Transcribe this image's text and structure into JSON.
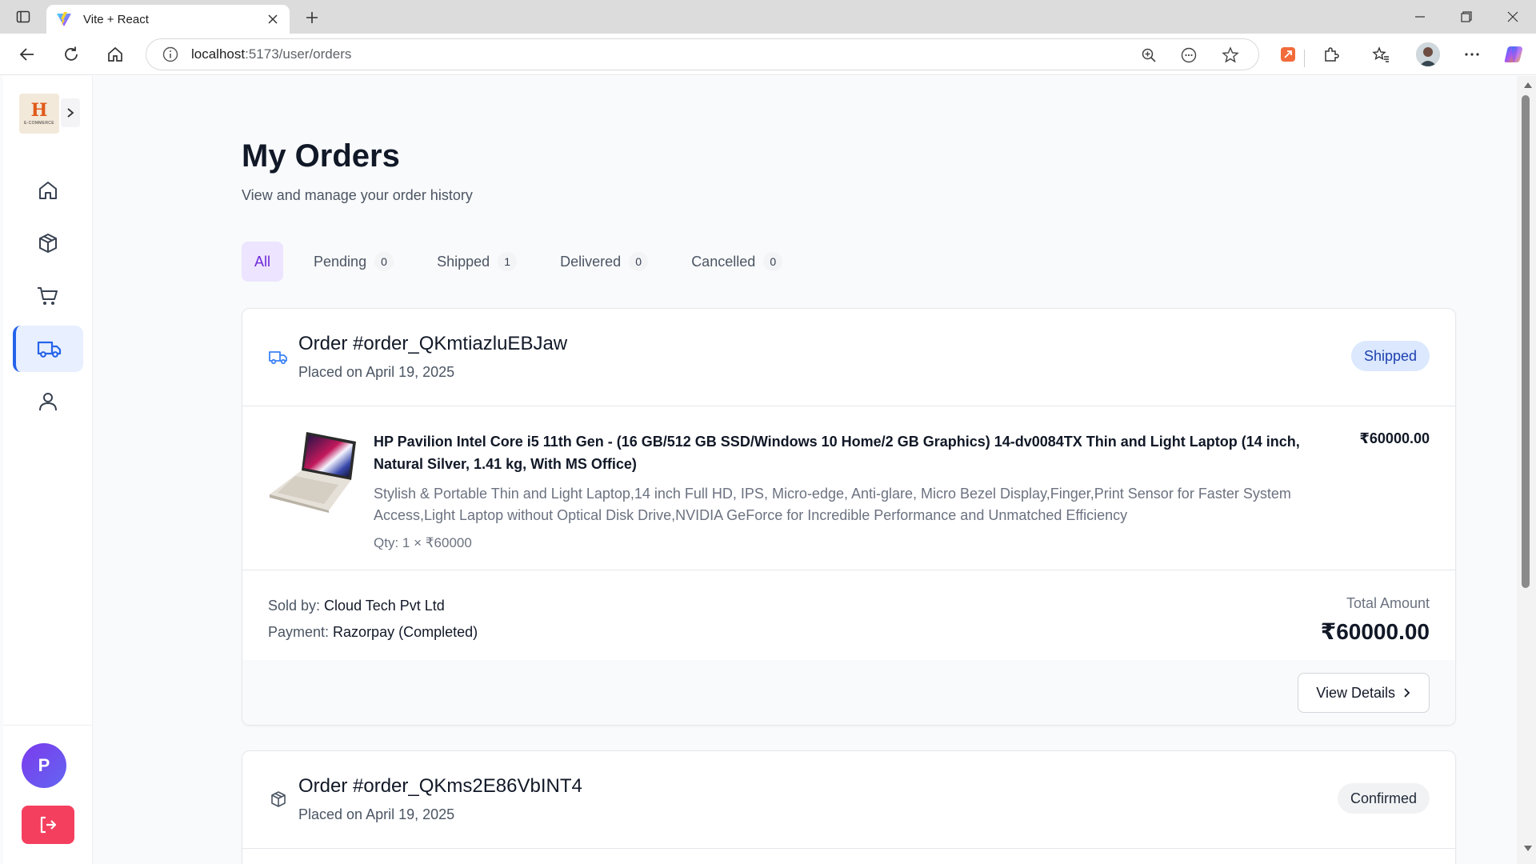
{
  "browser": {
    "tab_title": "Vite + React",
    "url_host": "localhost",
    "url_path": ":5173/user/orders"
  },
  "sidebar": {
    "logo_letter": "H",
    "logo_caption": "E-COMMERCE",
    "avatar_initial": "P",
    "items": [
      {
        "name": "home",
        "icon": "home-icon"
      },
      {
        "name": "products",
        "icon": "package-icon"
      },
      {
        "name": "cart",
        "icon": "cart-icon"
      },
      {
        "name": "orders",
        "icon": "truck-icon",
        "active": true
      },
      {
        "name": "profile",
        "icon": "user-icon"
      }
    ]
  },
  "page": {
    "title": "My Orders",
    "subtitle": "View and manage your order history"
  },
  "filter_tabs": [
    {
      "label": "All",
      "count": null,
      "active": true
    },
    {
      "label": "Pending",
      "count": "0"
    },
    {
      "label": "Shipped",
      "count": "1"
    },
    {
      "label": "Delivered",
      "count": "0"
    },
    {
      "label": "Cancelled",
      "count": "0"
    }
  ],
  "orders": [
    {
      "id": "Order #order_QKmtiazluEBJaw",
      "date": "Placed on April 19, 2025",
      "status": "Shipped",
      "item": {
        "name": "HP Pavilion Intel Core i5 11th Gen - (16 GB/512 GB SSD/Windows 10 Home/2 GB Graphics) 14-dv0084TX Thin and Light Laptop (14 inch, Natural Silver, 1.41 kg, With MS Office)",
        "price": "₹60000.00",
        "description": "Stylish & Portable Thin and Light Laptop,14 inch Full HD, IPS, Micro-edge, Anti-glare, Micro Bezel Display,Finger,Print Sensor for Faster System Access,Light Laptop without Optical Disk Drive,NVIDIA GeForce for Incredible Performance and Unmatched Efficiency",
        "qty": "Qty: 1 × ₹60000"
      },
      "sold_by_label": "Sold by: ",
      "sold_by": "Cloud Tech Pvt Ltd",
      "payment_label": "Payment: ",
      "payment": "Razorpay (Completed)",
      "total_label": "Total Amount",
      "total": "₹60000.00",
      "view_details_label": "View Details"
    },
    {
      "id": "Order #order_QKms2E86VbINT4",
      "date": "Placed on April 19, 2025",
      "status": "Confirmed"
    }
  ],
  "colors": {
    "accent": "#6d28d9",
    "active_nav": "#2563eb",
    "shipped_badge_bg": "#dbe8fe",
    "logout": "#f43f5e"
  }
}
